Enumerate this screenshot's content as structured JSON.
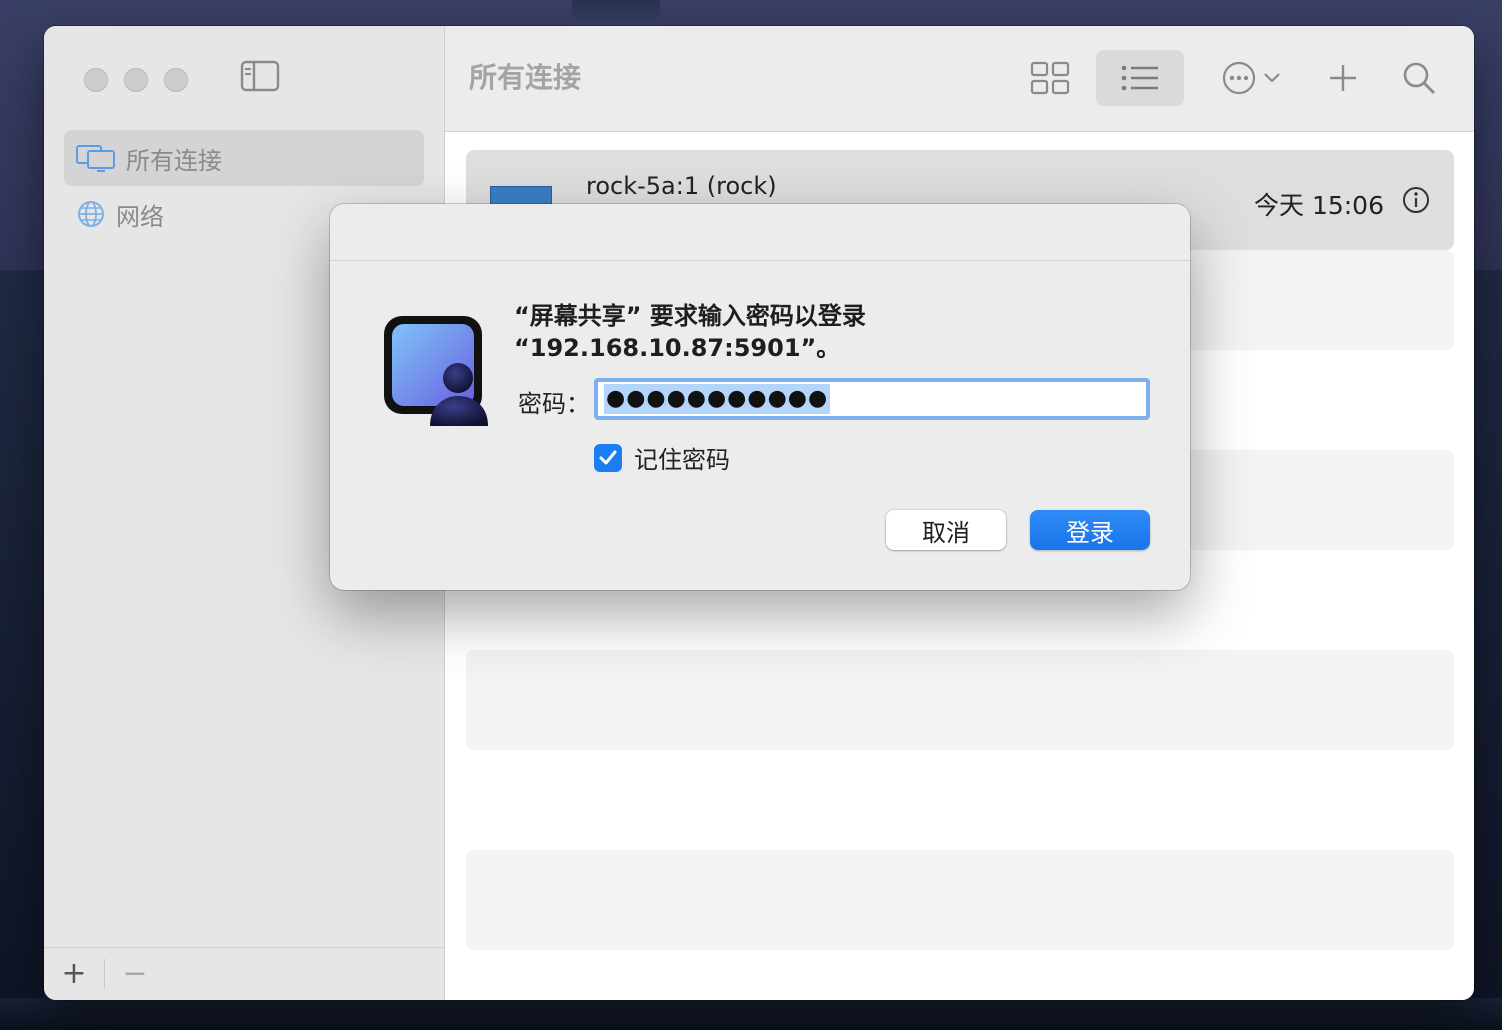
{
  "sidebar": {
    "items": [
      {
        "label": "所有连接",
        "icon": "displays-icon",
        "active": true
      },
      {
        "label": "网络",
        "icon": "globe-icon",
        "active": false
      }
    ],
    "bottom": {
      "add": "+",
      "remove": "−"
    }
  },
  "toolbar": {
    "title": "所有连接",
    "icons": [
      "grid-view-icon",
      "list-view-icon",
      "more-actions-icon",
      "chevron-down-icon",
      "add-icon",
      "search-icon"
    ]
  },
  "connections": [
    {
      "name": "rock-5a:1 (rock)",
      "time": "今天 15:06",
      "info_icon": "info-icon"
    }
  ],
  "dialog": {
    "message_line1": "“屏幕共享” 要求输入密码以登录",
    "message_line2": "“192.168.10.87:5901”。",
    "password_label": "密码：",
    "password_value": "●●●●●●●●●●●",
    "remember_label": "记住密码",
    "remember_checked": true,
    "cancel_label": "取消",
    "login_label": "登录"
  },
  "colors": {
    "accent": "#1b7cf3",
    "focus_ring": "#7fb1ec",
    "selection": "#b3d4fb",
    "sidebar_bg": "#e6e6e6"
  }
}
